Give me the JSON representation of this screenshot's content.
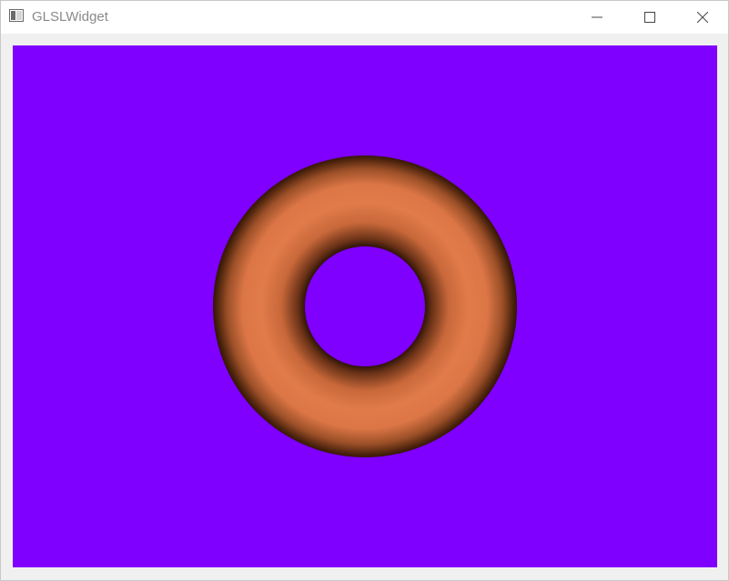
{
  "window": {
    "title": "GLSLWidget",
    "icon": "app-window-icon",
    "buttons": {
      "minimize": "minimize-icon",
      "maximize": "maximize-icon",
      "close": "close-icon"
    }
  },
  "viewport": {
    "background_color": "#7f00ff",
    "object": "torus",
    "object_color": "#e27b4a"
  }
}
